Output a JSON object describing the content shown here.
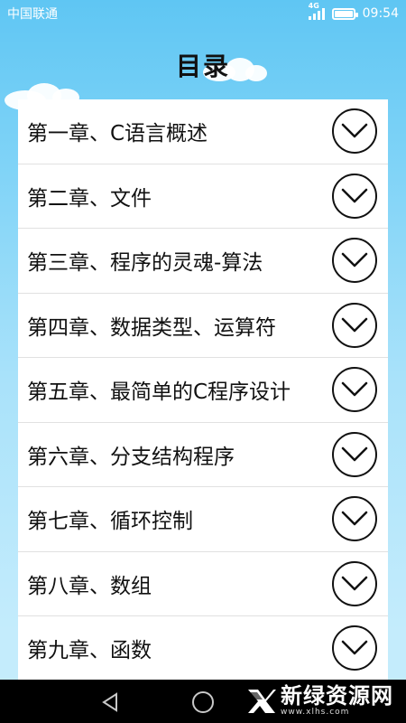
{
  "status_bar": {
    "carrier": "中国联通",
    "network": "4G",
    "time": "09:54"
  },
  "page": {
    "title": "目录"
  },
  "chapters": [
    {
      "label": "第一章、C语言概述",
      "icon": "chevron-down-circle-icon"
    },
    {
      "label": "第二章、文件",
      "icon": "chevron-down-circle-icon"
    },
    {
      "label": "第三章、程序的灵魂-算法",
      "icon": "chevron-down-circle-icon"
    },
    {
      "label": "第四章、数据类型、运算符",
      "icon": "chevron-down-circle-icon"
    },
    {
      "label": "第五章、最简单的C程序设计",
      "icon": "chevron-down-circle-icon"
    },
    {
      "label": "第六章、分支结构程序",
      "icon": "chevron-down-circle-icon"
    },
    {
      "label": "第七章、循环控制",
      "icon": "chevron-down-circle-icon"
    },
    {
      "label": "第八章、数组",
      "icon": "chevron-down-circle-icon"
    },
    {
      "label": "第九章、函数",
      "icon": "chevron-down-circle-icon"
    }
  ],
  "nav_bar": {
    "icons": [
      "back-icon",
      "home-icon"
    ]
  },
  "watermark": {
    "main": "新绿资源网",
    "sub": "www.xlhs.com"
  },
  "colors": {
    "sky_top": "#5fc6f3",
    "sky_bottom": "#c4ecfc",
    "list_bg": "#ffffff",
    "nav_bg": "#000000"
  }
}
